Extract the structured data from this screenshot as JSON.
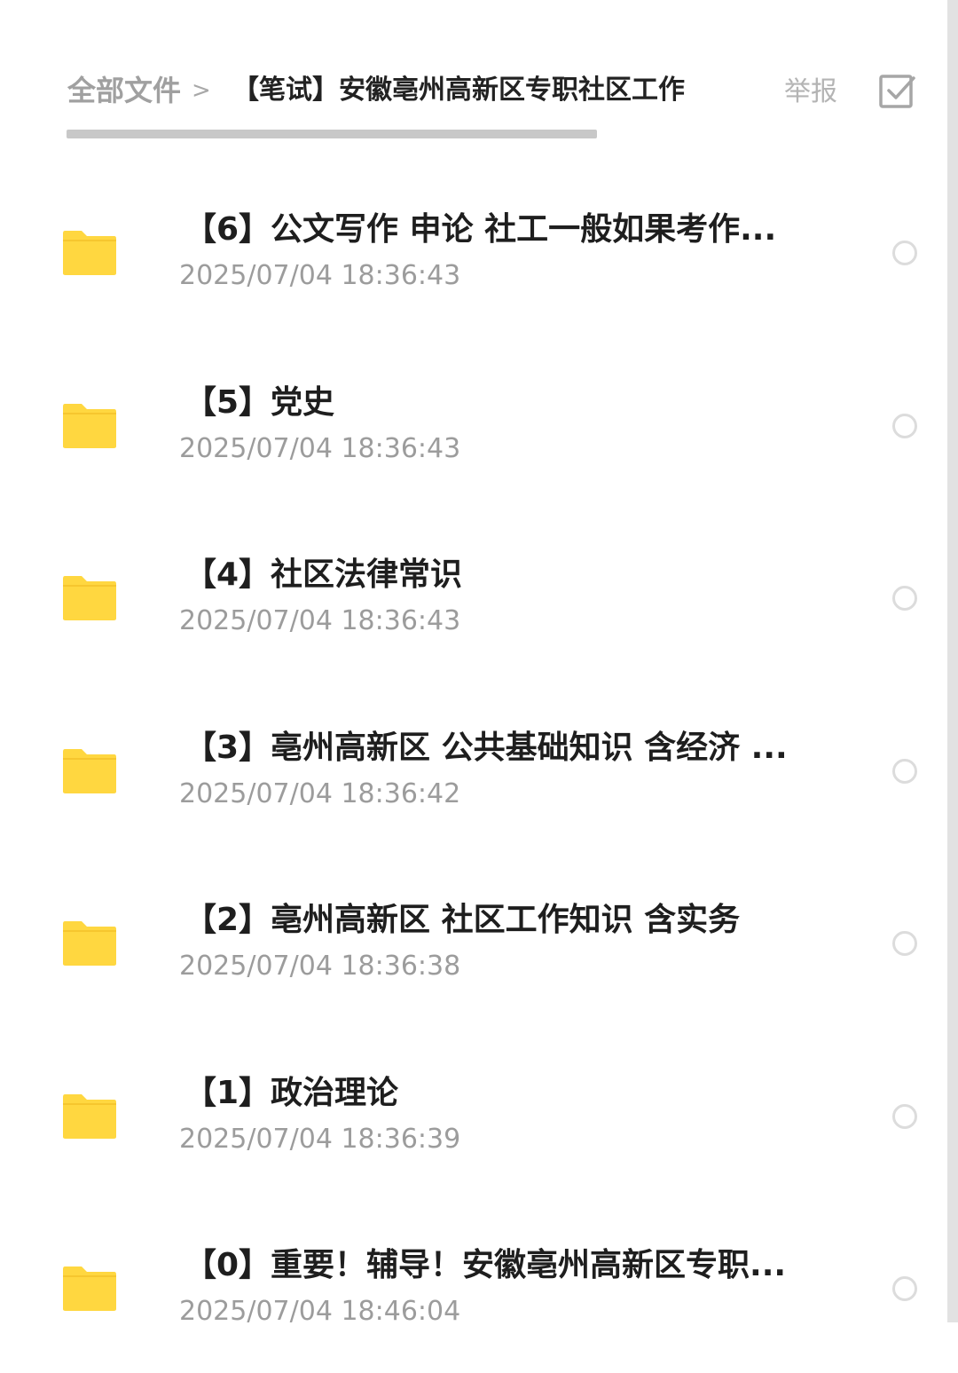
{
  "header": {
    "breadcrumb_root": "全部文件",
    "breadcrumb_separator": ">",
    "breadcrumb_current": "【笔试】安徽亳州高新区专职社区工作",
    "report_label": "举报"
  },
  "files": [
    {
      "name": "【6】公文写作 申论 社工一般如果考作...",
      "time": "2025/07/04 18:36:43"
    },
    {
      "name": "【5】党史",
      "time": "2025/07/04 18:36:43"
    },
    {
      "name": "【4】社区法律常识",
      "time": "2025/07/04 18:36:43"
    },
    {
      "name": "【3】亳州高新区 公共基础知识 含经济 ...",
      "time": "2025/07/04 18:36:42"
    },
    {
      "name": "【2】亳州高新区 社区工作知识 含实务",
      "time": "2025/07/04 18:36:38"
    },
    {
      "name": "【1】政治理论",
      "time": "2025/07/04 18:36:39"
    },
    {
      "name": "【0】重要！辅导！安徽亳州高新区专职...",
      "time": "2025/07/04 18:46:04"
    }
  ],
  "icons": {
    "folder": "folder-icon",
    "select": "checkbox-icon",
    "radio": "radio-unchecked-icon"
  },
  "colors": {
    "folder": "#FFD740",
    "text_primary": "#1e1e1e",
    "text_secondary": "#9c9c9c"
  }
}
